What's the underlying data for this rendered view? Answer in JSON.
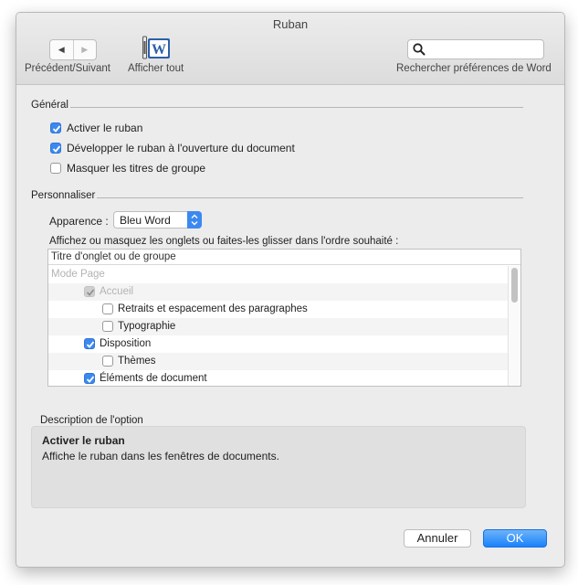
{
  "window": {
    "title": "Ruban"
  },
  "toolbar": {
    "nav_label": "Précédent/Suivant",
    "show_all_label": "Afficher tout",
    "search_label": "Rechercher préférences de Word",
    "search_placeholder": "",
    "show_all_icon": "word-app-icon"
  },
  "general": {
    "title": "Général",
    "options": [
      {
        "label": "Activer le ruban",
        "checked": true
      },
      {
        "label": "Développer le ruban à l'ouverture du document",
        "checked": true
      },
      {
        "label": "Masquer les titres de groupe",
        "checked": false
      }
    ]
  },
  "customize": {
    "title": "Personnaliser",
    "appearance_label": "Apparence :",
    "appearance_value": "Bleu Word",
    "instruction": "Affichez ou masquez les onglets ou faites-les glisser dans l'ordre souhaité :",
    "list_header": "Titre d'onglet ou de groupe",
    "rows": [
      {
        "label": "Mode Page",
        "disabled": true
      },
      {
        "label": "Accueil",
        "checked": true,
        "disabled": true
      },
      {
        "label": "Retraits et espacement des paragraphes",
        "checked": false
      },
      {
        "label": "Typographie",
        "checked": false
      },
      {
        "label": "Disposition",
        "checked": true
      },
      {
        "label": "Thèmes",
        "checked": false
      },
      {
        "label": "Éléments de document",
        "checked": true
      }
    ]
  },
  "description": {
    "title": "Description de l'option",
    "heading": "Activer le ruban",
    "text": "Affiche le ruban dans les fenêtres de documents."
  },
  "buttons": {
    "cancel": "Annuler",
    "ok": "OK"
  },
  "colors": {
    "accent": "#3b89f0",
    "window_bg": "#ececec"
  }
}
